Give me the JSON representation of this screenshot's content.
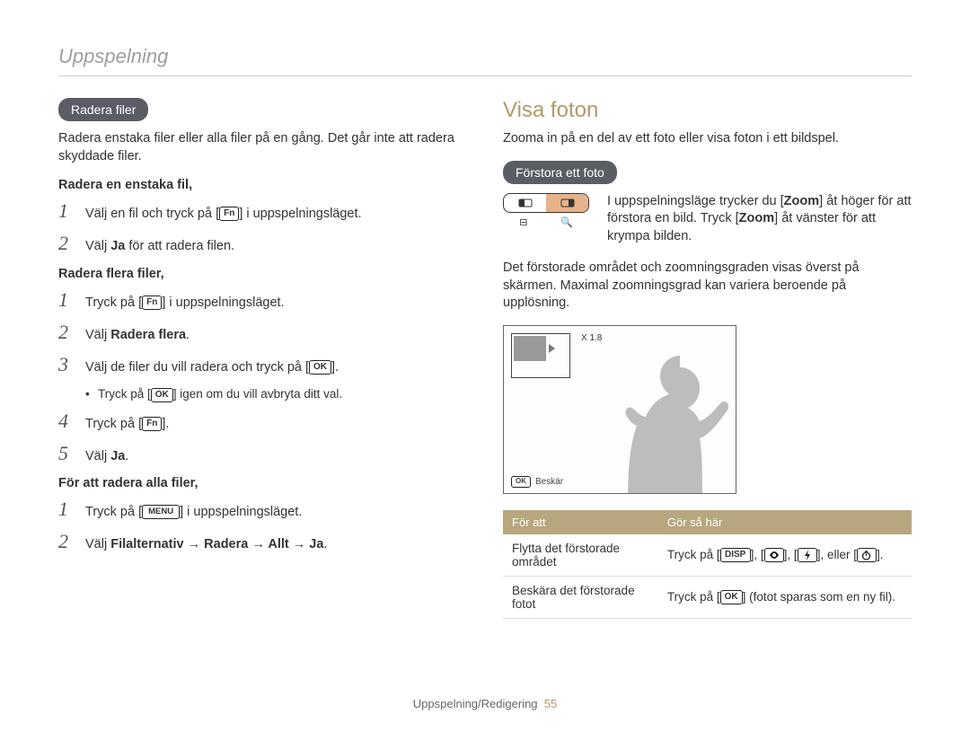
{
  "breadcrumb": "Uppspelning",
  "left": {
    "pill": "Radera filer",
    "intro": "Radera enstaka filer eller alla filer på en gång. Det går inte att radera skyddade filer.",
    "sub1": "Radera en enstaka fil,",
    "s1_1a": "Välj en fil och tryck på [",
    "s1_1b": "] i uppspelningsläget.",
    "s1_2a": "Välj ",
    "s1_2b": "Ja",
    "s1_2c": " för att radera filen.",
    "sub2": "Radera flera filer,",
    "s2_1a": "Tryck på [",
    "s2_1b": "] i uppspelningsläget.",
    "s2_2a": "Välj ",
    "s2_2b": "Radera flera",
    "s2_2c": ".",
    "s2_3a": "Välj de filer du vill radera och tryck på [",
    "s2_3b": "].",
    "s2_bullet_a": "Tryck på [",
    "s2_bullet_b": "] igen om du vill avbryta ditt val.",
    "s2_4a": "Tryck på [",
    "s2_4b": "].",
    "s2_5a": "Välj ",
    "s2_5b": "Ja",
    "s2_5c": ".",
    "sub3": "För att radera alla filer,",
    "s3_1a": "Tryck på [",
    "s3_1b": "] i uppspelningsläget.",
    "s3_2a": "Välj ",
    "s3_2b": "Filalternativ → Radera → Allt → Ja",
    "s3_2c": "."
  },
  "right": {
    "title": "Visa foton",
    "intro": "Zooma in på en del av ett foto eller visa foton i ett bildspel.",
    "pill": "Förstora ett foto",
    "zoom_desc_a": "I uppspelningsläge trycker du [",
    "zoom_desc_b": "] åt höger för att förstora en bild. Tryck [",
    "zoom_desc_c": "] åt vänster för att krympa bilden.",
    "zoom_word": "Zoom",
    "para2": "Det förstorade området och zoomningsgraden visas överst på skärmen. Maximal zoomningsgrad kan variera beroende på upplösning.",
    "cam_zoom_label": "X 1.8",
    "cam_crop": "Beskär",
    "table": {
      "h1": "För att",
      "h2": "Gör så här",
      "r1c1": "Flytta det förstorade området",
      "r1c2a": "Tryck på [",
      "r1c2b": "], [",
      "r1c2c": "], eller [",
      "r1c2d": "].",
      "r2c1": "Beskära det förstorade fotot",
      "r2c2a": "Tryck på [",
      "r2c2b": "] (fotot sparas som en ny fil)."
    }
  },
  "key": {
    "fn": "Fn",
    "ok": "OK",
    "menu": "MENU",
    "disp": "DISP"
  },
  "footer": {
    "section": "Uppspelning/Redigering",
    "page": "55"
  }
}
